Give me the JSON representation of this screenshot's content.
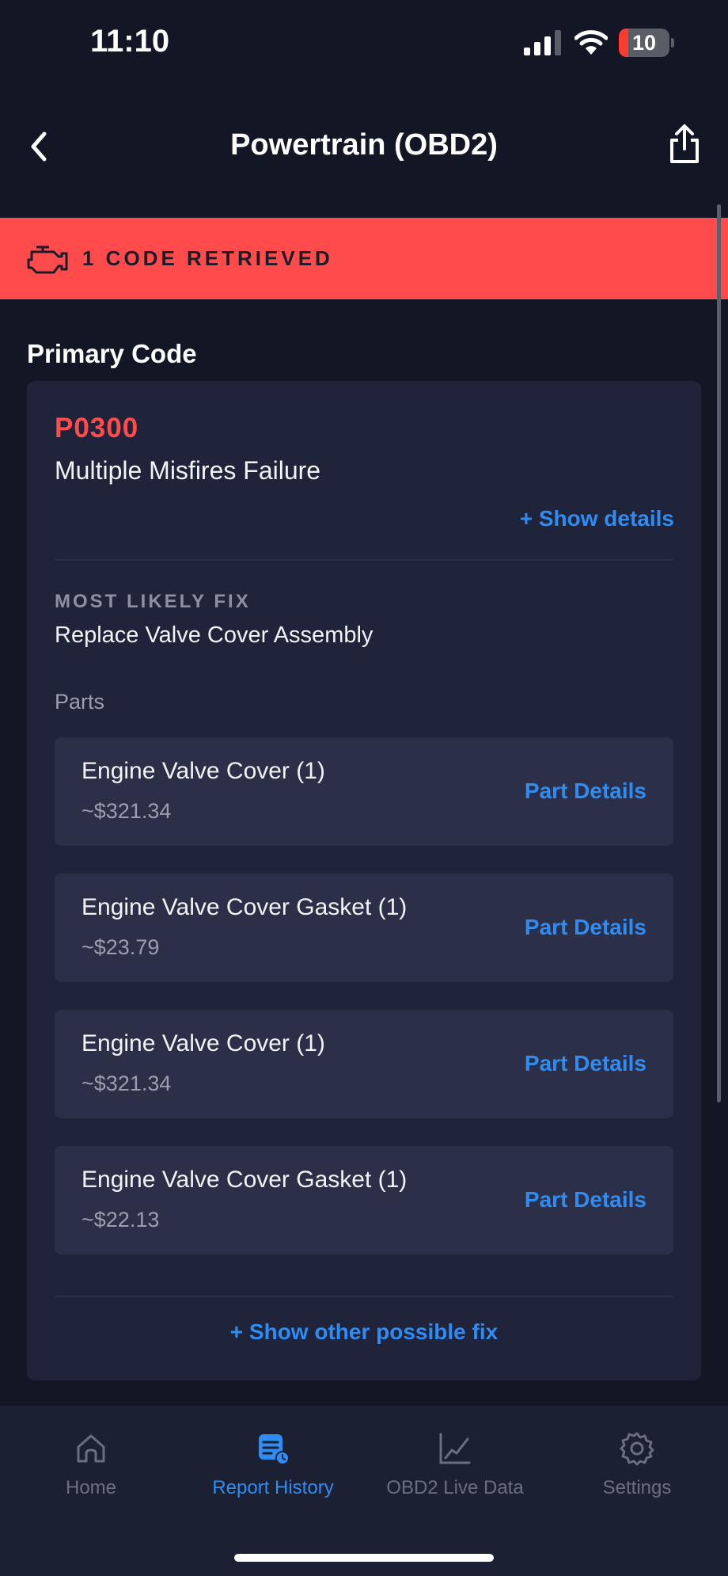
{
  "status_bar": {
    "time": "11:10",
    "battery_level": "10",
    "battery_fraction": 0.1,
    "battery_color": "#ff3b30"
  },
  "header": {
    "title": "Powertrain (OBD2)",
    "back_icon": "chevron-left-icon",
    "share_icon": "share-icon"
  },
  "banner": {
    "text": "1 CODE RETRIEVED",
    "icon": "engine-icon",
    "color": "#ff4b4b"
  },
  "primary": {
    "section_title": "Primary Code",
    "code": "P0300",
    "description": "Multiple Misfires Failure",
    "show_details": "+ Show details",
    "fix_label": "MOST LIKELY FIX",
    "fix_value": "Replace Valve Cover Assembly",
    "parts_label": "Parts",
    "parts": [
      {
        "name": "Engine Valve Cover (1)",
        "price": "~$321.34",
        "button": "Part Details"
      },
      {
        "name": "Engine Valve Cover Gasket (1)",
        "price": "~$23.79",
        "button": "Part Details"
      },
      {
        "name": "Engine Valve Cover (1)",
        "price": "~$321.34",
        "button": "Part Details"
      },
      {
        "name": "Engine Valve Cover Gasket (1)",
        "price": "~$22.13",
        "button": "Part Details"
      }
    ],
    "other_fix": "+ Show other possible fix"
  },
  "tabbar": {
    "active": "Report History",
    "tabs": [
      {
        "label": "Home",
        "icon": "home-icon"
      },
      {
        "label": "Report History",
        "icon": "report-history-icon"
      },
      {
        "label": "OBD2 Live Data",
        "icon": "line-chart-icon"
      },
      {
        "label": "Settings",
        "icon": "gear-icon"
      }
    ]
  },
  "colors": {
    "background": "#121625",
    "card": "#20243a",
    "part_card": "#2b3048",
    "accent": "#2e8cf2",
    "code_red": "#ff4b4b"
  }
}
